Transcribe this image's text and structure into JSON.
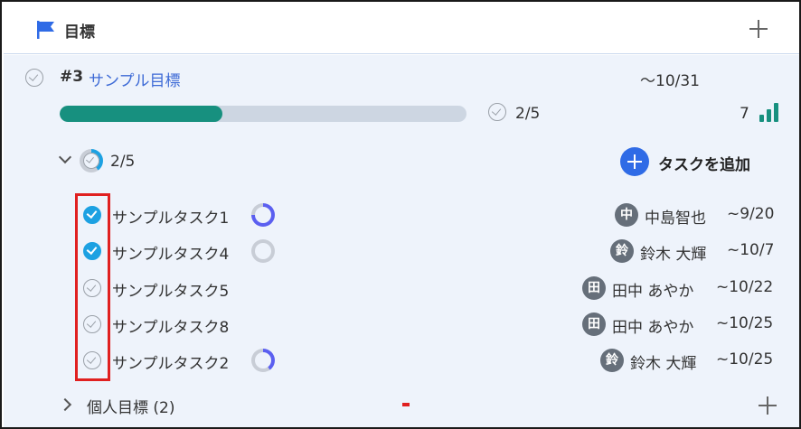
{
  "header": {
    "title": "目標",
    "flag_icon": "flag-icon",
    "add_icon": "plus-icon"
  },
  "goal": {
    "number": "#3",
    "name": "サンプル目標",
    "due": "〜10/31",
    "progress": 0.4,
    "progress_count": "2/5",
    "score": "7",
    "score_icon": "bar-chart-icon",
    "colors": {
      "progress_fill": "#17907f",
      "progress_track": "#cdd6e2",
      "link": "#3d6ad6",
      "accent": "#2f6be6",
      "done": "#1da1e2"
    }
  },
  "tasks_section": {
    "count": "2/5",
    "add_task_label": "タスクを追加"
  },
  "tasks": [
    {
      "name": "サンプルタスク1",
      "done": true,
      "progress": 0.75,
      "avatar": "中",
      "assignee": "中島智也",
      "due": "~9/20"
    },
    {
      "name": "サンプルタスク4",
      "done": true,
      "progress": 0.0,
      "avatar": "鈴",
      "assignee": "鈴木 大輝",
      "due": "~10/7"
    },
    {
      "name": "サンプルタスク5",
      "done": false,
      "progress": null,
      "avatar": "田",
      "assignee": "田中 あやか",
      "due": "~10/22"
    },
    {
      "name": "サンプルタスク8",
      "done": false,
      "progress": null,
      "avatar": "田",
      "assignee": "田中 あやか",
      "due": "~10/25"
    },
    {
      "name": "サンプルタスク2",
      "done": false,
      "progress": 0.4,
      "avatar": "鈴",
      "assignee": "鈴木 大輝",
      "due": "~10/25"
    }
  ],
  "personal_goals": {
    "label": "個人目標 (2)"
  }
}
